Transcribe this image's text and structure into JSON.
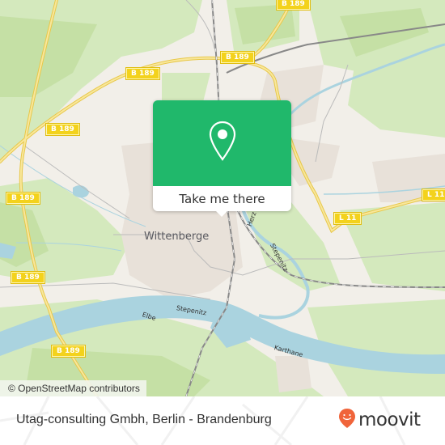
{
  "map": {
    "city_label": "Wittenberge",
    "road_shields": [
      {
        "id": "b189-top-right",
        "label": "B 189"
      },
      {
        "id": "b189-north",
        "label": "B 189"
      },
      {
        "id": "b189-northwest",
        "label": "B 189"
      },
      {
        "id": "b189-west",
        "label": "B 189"
      },
      {
        "id": "b189-west-lower",
        "label": "B 189"
      },
      {
        "id": "b189-west-south",
        "label": "B 189"
      },
      {
        "id": "b189-south",
        "label": "B 189"
      },
      {
        "id": "l11-east",
        "label": "L 11"
      },
      {
        "id": "l11-edge",
        "label": "L 11"
      }
    ],
    "river_labels": {
      "elbe": "Elbe",
      "stepenitz_south": "Stepenitz",
      "stepenitz_east": "Stepenitz",
      "karthane": "Karthane",
      "herz": "Herz"
    },
    "attribution": "© OpenStreetMap contributors",
    "colors": {
      "land": "#f2efe9",
      "forest": "#cfe6b4",
      "water": "#aad3df",
      "road_primary": "#f6de72",
      "urban": "#e9e3dc"
    }
  },
  "popup": {
    "icon": "location-pin-icon",
    "button_label": "Take me there",
    "color": "#20b86b"
  },
  "footer": {
    "place_name": "Utag-consulting Gmbh, Berlin - Brandenburg",
    "brand": "moovit",
    "brand_color": "#f0643a"
  }
}
